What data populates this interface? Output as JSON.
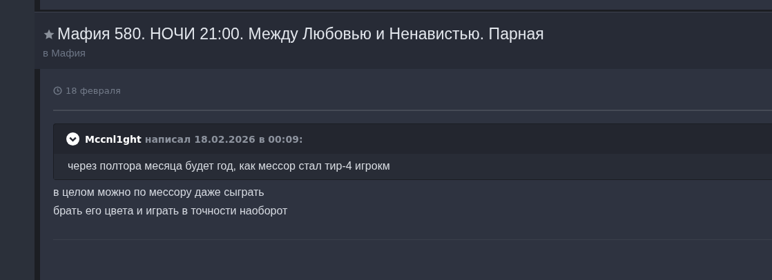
{
  "topic": {
    "title": "Мафия 580. НОЧИ 21:00. Между Любовью и Ненавистью. Парная",
    "category": "в Мафия"
  },
  "post": {
    "date": "18 февраля",
    "quote": {
      "author": "Mccnl1ght",
      "meta": "написал 18.02.2026 в 00:09:",
      "text": "через полтора месяца будет год, как мессор стал тир-4 игрокм"
    },
    "lines": [
      "в целом можно по мессору даже сыграть",
      "брать его цвета и играть в точности наоборот"
    ]
  }
}
